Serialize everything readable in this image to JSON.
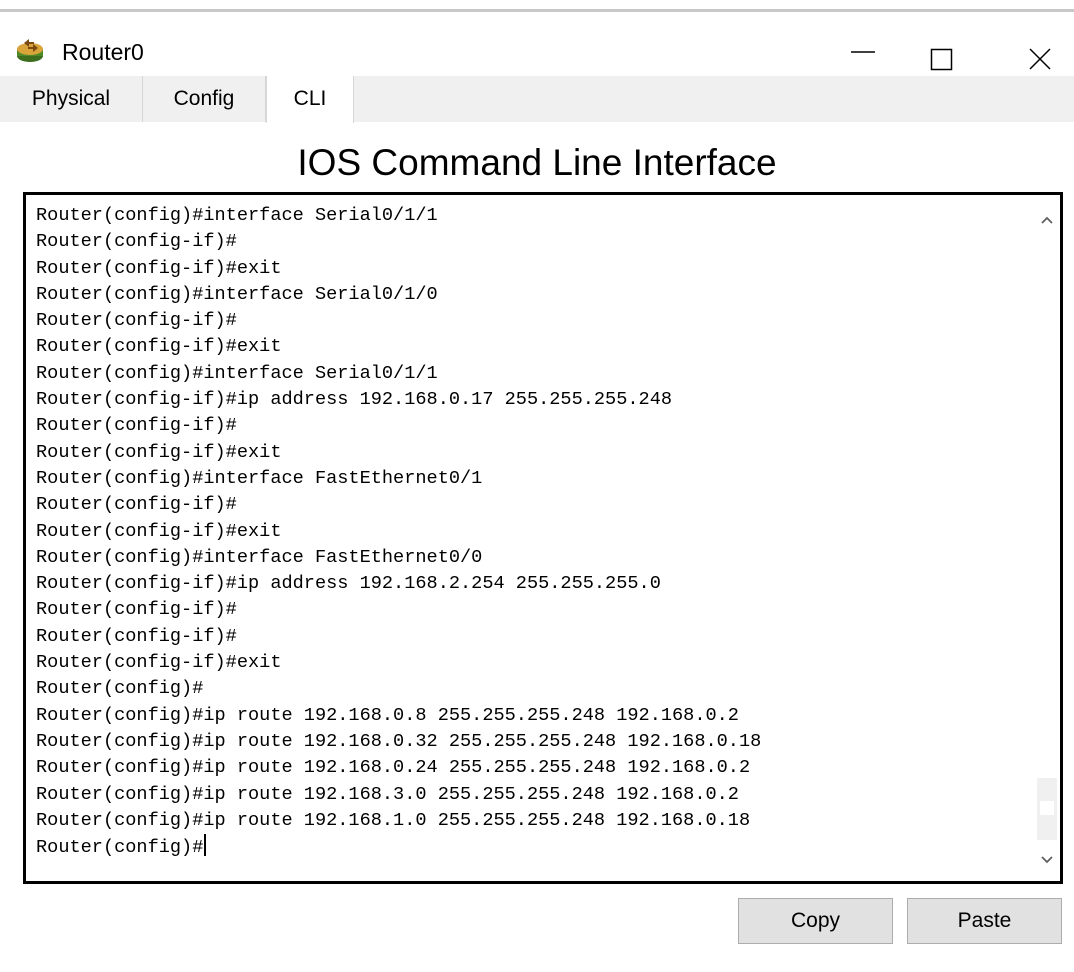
{
  "window": {
    "title": "Router0",
    "icon": "router-icon",
    "controls": [
      "minimize-icon",
      "maximize-icon",
      "close-icon"
    ]
  },
  "tabs": [
    {
      "label": "Physical"
    },
    {
      "label": "Config"
    },
    {
      "label": "CLI",
      "active": true
    }
  ],
  "heading": "IOS Command Line Interface",
  "terminal": {
    "lines": [
      "Router(config)#interface Serial0/1/1",
      "Router(config-if)#",
      "Router(config-if)#exit",
      "Router(config)#interface Serial0/1/0",
      "Router(config-if)#",
      "Router(config-if)#exit",
      "Router(config)#interface Serial0/1/1",
      "Router(config-if)#ip address 192.168.0.17 255.255.255.248",
      "Router(config-if)#",
      "Router(config-if)#exit",
      "Router(config)#interface FastEthernet0/1",
      "Router(config-if)#",
      "Router(config-if)#exit",
      "Router(config)#interface FastEthernet0/0",
      "Router(config-if)#ip address 192.168.2.254 255.255.255.0",
      "Router(config-if)#",
      "Router(config-if)#",
      "Router(config-if)#exit",
      "Router(config)#",
      "Router(config)#ip route 192.168.0.8 255.255.255.248 192.168.0.2",
      "Router(config)#ip route 192.168.0.32 255.255.255.248 192.168.0.18",
      "Router(config)#ip route 192.168.0.24 255.255.255.248 192.168.0.2",
      "Router(config)#ip route 192.168.3.0 255.255.255.248 192.168.0.2",
      "Router(config)#ip route 192.168.1.0 255.255.255.248 192.168.0.18"
    ],
    "prompt": "Router(config)#",
    "scroll_position": 0.97
  },
  "buttons": {
    "copy": "Copy",
    "paste": "Paste"
  }
}
